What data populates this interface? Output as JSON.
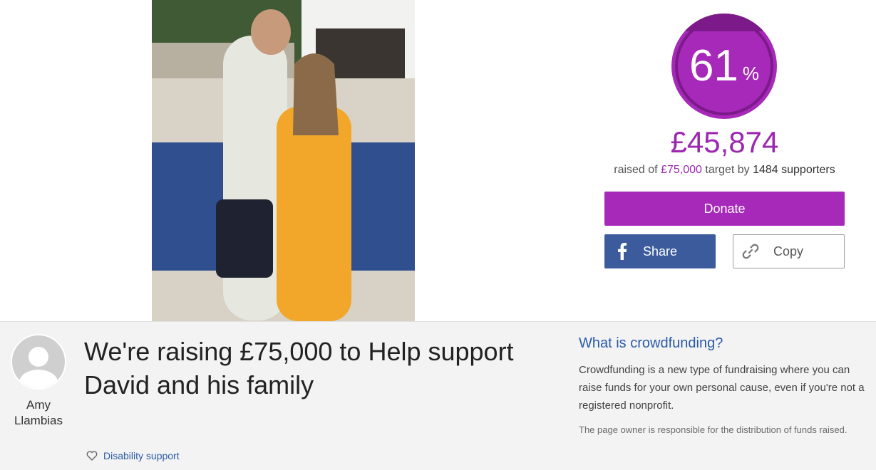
{
  "progress": {
    "percent_number": "61",
    "percent_sign": "%",
    "fraction": 0.61,
    "ring_color": "#a729b9",
    "ring_dark": "#7b1a88"
  },
  "stats": {
    "raised_amount": "£45,874",
    "raised_prefix": "raised of",
    "target": "£75,000",
    "target_mid": "target by",
    "supporters": "1484 supporters"
  },
  "actions": {
    "donate_label": "Donate",
    "share_label": "Share",
    "copy_label": "Copy"
  },
  "icons": {
    "share": "facebook-icon",
    "copy": "link-icon",
    "category": "heart-icon",
    "avatar": "user-avatar-icon"
  },
  "owner": {
    "name": "Amy Llambias"
  },
  "campaign": {
    "title": "We're raising £75,000 to Help support David and his family",
    "category": "Disability support"
  },
  "crowdfunding_info": {
    "heading": "What is crowdfunding?",
    "body": "Crowdfunding is a new type of fundraising where you can raise funds for your own personal cause, even if you're not a registered nonprofit.",
    "note": "The page owner is responsible for the distribution of funds raised."
  },
  "colors": {
    "brand_purple": "#a729b9",
    "facebook_blue": "#3b5b9d",
    "link_blue": "#2b5aa8",
    "band_grey": "#f3f3f3"
  }
}
